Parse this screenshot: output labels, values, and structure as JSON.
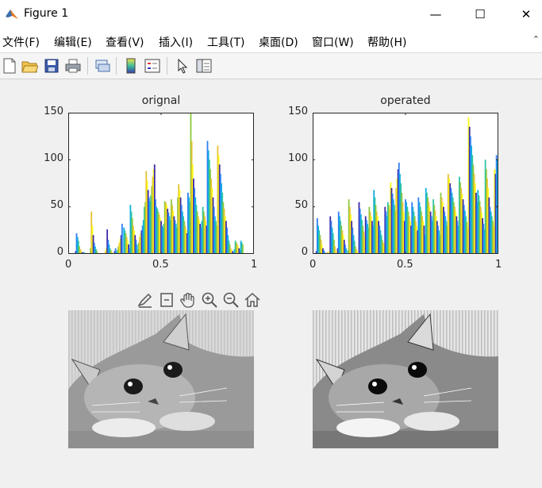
{
  "window": {
    "title": "Figure 1",
    "minimize": "—",
    "maximize": "☐",
    "close": "✕"
  },
  "menu": [
    "文件(F)",
    "编辑(E)",
    "查看(V)",
    "插入(I)",
    "工具(T)",
    "桌面(D)",
    "窗口(W)",
    "帮助(H)"
  ],
  "menu_overflow": "⌃",
  "toolbar": [
    "new-figure-icon",
    "open-icon",
    "save-icon",
    "print-icon",
    "link-icon",
    "colorbar-icon",
    "legend-icon",
    "pointer-icon",
    "property-inspector-icon"
  ],
  "axes_toolbar": [
    "brush-icon",
    "data-tips-icon",
    "pan-icon",
    "zoom-in-icon",
    "zoom-out-icon",
    "home-icon"
  ],
  "chart_data": [
    {
      "type": "bar",
      "title": "orignal",
      "xlim": [
        0,
        1
      ],
      "ylim": [
        0,
        150
      ],
      "x_ticks": [
        "0",
        "0.5",
        "1"
      ],
      "y_ticks": [
        "0",
        "50",
        "100",
        "150"
      ],
      "x": [
        0.04,
        0.045,
        0.05,
        0.055,
        0.06,
        0.065,
        0.07,
        0.075,
        0.08,
        0.085,
        0.09,
        0.12,
        0.125,
        0.13,
        0.135,
        0.14,
        0.145,
        0.15,
        0.155,
        0.2,
        0.205,
        0.21,
        0.215,
        0.22,
        0.225,
        0.23,
        0.235,
        0.24,
        0.25,
        0.255,
        0.26,
        0.265,
        0.27,
        0.275,
        0.28,
        0.285,
        0.29,
        0.3,
        0.305,
        0.31,
        0.315,
        0.32,
        0.325,
        0.33,
        0.335,
        0.34,
        0.345,
        0.35,
        0.355,
        0.36,
        0.365,
        0.37,
        0.375,
        0.38,
        0.385,
        0.39,
        0.395,
        0.4,
        0.405,
        0.41,
        0.415,
        0.42,
        0.425,
        0.43,
        0.435,
        0.44,
        0.445,
        0.45,
        0.455,
        0.46,
        0.465,
        0.47,
        0.475,
        0.48,
        0.485,
        0.49,
        0.495,
        0.5,
        0.505,
        0.51,
        0.515,
        0.52,
        0.525,
        0.53,
        0.535,
        0.54,
        0.545,
        0.55,
        0.555,
        0.56,
        0.565,
        0.57,
        0.575,
        0.58,
        0.585,
        0.59,
        0.595,
        0.6,
        0.605,
        0.61,
        0.615,
        0.62,
        0.625,
        0.63,
        0.635,
        0.64,
        0.645,
        0.65,
        0.655,
        0.66,
        0.665,
        0.67,
        0.675,
        0.68,
        0.685,
        0.69,
        0.695,
        0.7,
        0.705,
        0.71,
        0.715,
        0.72,
        0.725,
        0.73,
        0.735,
        0.74,
        0.745,
        0.75,
        0.755,
        0.76,
        0.765,
        0.77,
        0.775,
        0.78,
        0.785,
        0.79,
        0.795,
        0.8,
        0.805,
        0.81,
        0.815,
        0.82,
        0.825,
        0.83,
        0.835,
        0.84,
        0.845,
        0.85,
        0.855,
        0.86,
        0.865,
        0.87,
        0.875,
        0.88,
        0.885,
        0.89,
        0.895,
        0.9,
        0.905,
        0.91,
        0.915,
        0.92,
        0.925,
        0.93,
        0.935,
        0.94
      ],
      "values": [
        3,
        22,
        18,
        14,
        8,
        5,
        3,
        2,
        1,
        2,
        1,
        6,
        45,
        30,
        20,
        12,
        8,
        5,
        3,
        3,
        6,
        26,
        15,
        10,
        6,
        4,
        2,
        1,
        3,
        6,
        2,
        4,
        8,
        12,
        16,
        20,
        32,
        28,
        25,
        22,
        18,
        14,
        10,
        6,
        52,
        45,
        38,
        30,
        25,
        20,
        15,
        10,
        5,
        12,
        18,
        22,
        25,
        30,
        36,
        50,
        55,
        88,
        78,
        68,
        60,
        56,
        62,
        72,
        82,
        90,
        95,
        58,
        50,
        48,
        45,
        42,
        38,
        35,
        30,
        28,
        32,
        56,
        55,
        52,
        48,
        44,
        40,
        36,
        58,
        52,
        46,
        40,
        36,
        32,
        28,
        60,
        74,
        68,
        60,
        52,
        45,
        40,
        35,
        30,
        26,
        22,
        65,
        60,
        55,
        150,
        120,
        95,
        80,
        70,
        60,
        52,
        45,
        40,
        36,
        32,
        28,
        35,
        50,
        45,
        40,
        35,
        30,
        120,
        110,
        100,
        90,
        80,
        70,
        60,
        50,
        40,
        35,
        30,
        115,
        105,
        95,
        85,
        75,
        65,
        55,
        48,
        40,
        35,
        28,
        20,
        14,
        10,
        6,
        4,
        3,
        2,
        5,
        14,
        12,
        10,
        8,
        6,
        4,
        14,
        12,
        10,
        8,
        5
      ]
    },
    {
      "type": "bar",
      "title": "operated",
      "xlim": [
        0,
        1
      ],
      "ylim": [
        0,
        150
      ],
      "x_ticks": [
        "0",
        "0.5",
        "1"
      ],
      "y_ticks": [
        "0",
        "50",
        "100",
        "150"
      ],
      "x": [
        0.02,
        0.025,
        0.03,
        0.035,
        0.04,
        0.045,
        0.05,
        0.055,
        0.06,
        0.065,
        0.07,
        0.075,
        0.08,
        0.09,
        0.095,
        0.1,
        0.105,
        0.11,
        0.115,
        0.12,
        0.13,
        0.135,
        0.14,
        0.145,
        0.15,
        0.155,
        0.16,
        0.165,
        0.17,
        0.175,
        0.18,
        0.19,
        0.195,
        0.2,
        0.205,
        0.21,
        0.215,
        0.22,
        0.225,
        0.23,
        0.235,
        0.24,
        0.25,
        0.255,
        0.26,
        0.265,
        0.27,
        0.275,
        0.28,
        0.285,
        0.29,
        0.295,
        0.3,
        0.305,
        0.31,
        0.315,
        0.32,
        0.325,
        0.33,
        0.335,
        0.34,
        0.345,
        0.35,
        0.355,
        0.36,
        0.365,
        0.37,
        0.375,
        0.38,
        0.385,
        0.39,
        0.395,
        0.4,
        0.405,
        0.41,
        0.415,
        0.42,
        0.425,
        0.43,
        0.435,
        0.44,
        0.445,
        0.45,
        0.455,
        0.46,
        0.465,
        0.47,
        0.475,
        0.48,
        0.485,
        0.49,
        0.495,
        0.5,
        0.505,
        0.51,
        0.515,
        0.52,
        0.525,
        0.53,
        0.535,
        0.54,
        0.545,
        0.55,
        0.555,
        0.56,
        0.565,
        0.57,
        0.575,
        0.58,
        0.585,
        0.59,
        0.595,
        0.6,
        0.605,
        0.61,
        0.615,
        0.62,
        0.625,
        0.63,
        0.635,
        0.64,
        0.645,
        0.65,
        0.655,
        0.66,
        0.665,
        0.67,
        0.675,
        0.68,
        0.685,
        0.69,
        0.695,
        0.7,
        0.705,
        0.71,
        0.715,
        0.72,
        0.725,
        0.73,
        0.735,
        0.74,
        0.745,
        0.75,
        0.755,
        0.76,
        0.765,
        0.77,
        0.775,
        0.78,
        0.785,
        0.79,
        0.795,
        0.8,
        0.805,
        0.81,
        0.815,
        0.82,
        0.825,
        0.83,
        0.835,
        0.84,
        0.845,
        0.85,
        0.855,
        0.86,
        0.865,
        0.87,
        0.875,
        0.88,
        0.885,
        0.89,
        0.895,
        0.9,
        0.905,
        0.91,
        0.915,
        0.92,
        0.925,
        0.93,
        0.935,
        0.94,
        0.945,
        0.95,
        0.955,
        0.96,
        0.965,
        0.97,
        0.975,
        0.98,
        0.985,
        0.99,
        0.995,
        1.0
      ],
      "values": [
        3,
        38,
        30,
        25,
        20,
        15,
        10,
        6,
        4,
        2,
        1,
        1,
        2,
        3,
        40,
        35,
        28,
        22,
        15,
        8,
        4,
        6,
        45,
        40,
        35,
        30,
        25,
        20,
        15,
        10,
        6,
        4,
        58,
        50,
        42,
        35,
        28,
        20,
        14,
        8,
        5,
        3,
        55,
        48,
        42,
        36,
        30,
        24,
        18,
        40,
        36,
        32,
        28,
        50,
        45,
        40,
        35,
        30,
        68,
        60,
        52,
        45,
        40,
        35,
        30,
        25,
        20,
        15,
        12,
        10,
        50,
        45,
        40,
        55,
        52,
        48,
        76,
        70,
        64,
        58,
        52,
        46,
        70,
        80,
        90,
        97,
        85,
        75,
        65,
        55,
        45,
        35,
        58,
        55,
        50,
        45,
        40,
        35,
        30,
        55,
        50,
        45,
        40,
        35,
        30,
        25,
        60,
        55,
        50,
        45,
        40,
        35,
        30,
        20,
        70,
        65,
        60,
        55,
        50,
        45,
        40,
        35,
        58,
        52,
        46,
        40,
        35,
        30,
        25,
        20,
        65,
        60,
        55,
        50,
        45,
        40,
        35,
        30,
        85,
        80,
        75,
        70,
        65,
        60,
        55,
        50,
        45,
        40,
        35,
        30,
        82,
        76,
        70,
        64,
        58,
        52,
        46,
        40,
        34,
        28,
        145,
        135,
        125,
        115,
        105,
        95,
        85,
        75,
        65,
        55,
        68,
        62,
        56,
        50,
        44,
        38,
        32,
        26,
        100,
        90,
        80,
        70,
        60,
        50,
        45,
        40,
        35,
        30,
        90,
        85,
        105,
        100,
        95,
        90,
        85,
        80,
        75,
        70,
        65,
        60,
        85
      ]
    }
  ]
}
